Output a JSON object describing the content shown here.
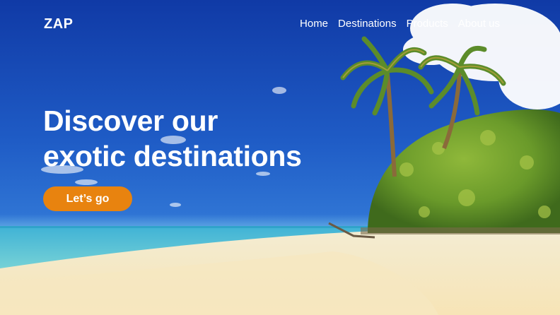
{
  "brand": {
    "logo_text": "ZAP"
  },
  "nav": {
    "items": [
      {
        "label": "Home"
      },
      {
        "label": "Destinations"
      },
      {
        "label": "Products"
      },
      {
        "label": "About us"
      }
    ]
  },
  "hero": {
    "headline_line1": "Discover our",
    "headline_line2": "exotic destinations",
    "cta_label": "Let’s go",
    "background_image": "tropical-beach-palm-trees"
  },
  "colors": {
    "accent": "#e8830f",
    "sky": "#1b4fb8",
    "text": "#ffffff"
  }
}
